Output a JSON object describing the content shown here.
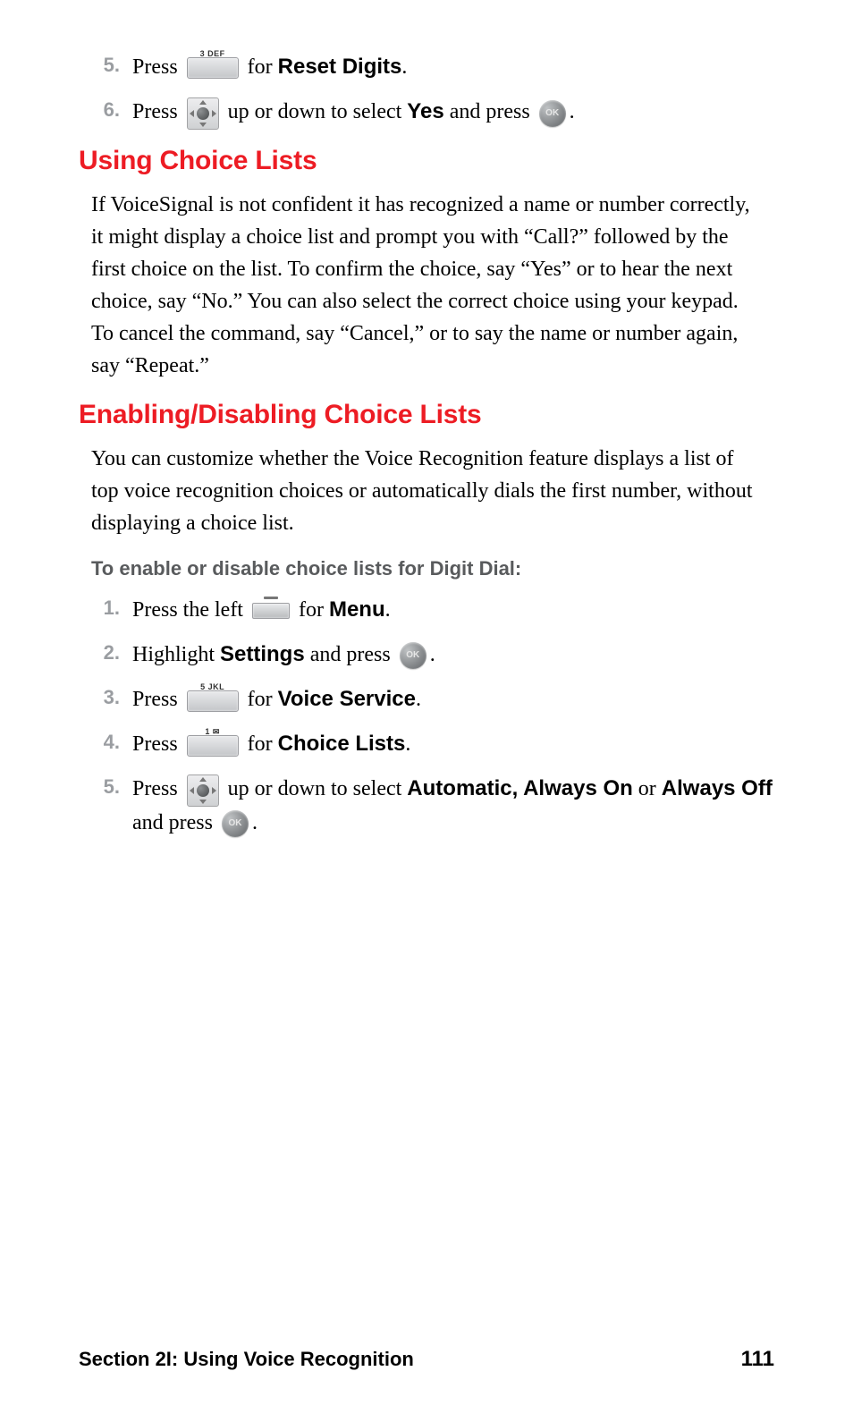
{
  "top_steps": [
    {
      "num": "5.",
      "segments": [
        {
          "t": "Press ",
          "b": false
        },
        {
          "icon": "key3",
          "label": "3 DEF"
        },
        {
          "t": " for ",
          "b": false
        },
        {
          "t": "Reset Digits",
          "b": true
        },
        {
          "t": ".",
          "b": false
        }
      ]
    },
    {
      "num": "6.",
      "segments": [
        {
          "t": "Press ",
          "b": false
        },
        {
          "icon": "nav"
        },
        {
          "t": " up or down to select ",
          "b": false
        },
        {
          "t": "Yes",
          "b": true
        },
        {
          "t": " and press ",
          "b": false
        },
        {
          "icon": "ok"
        },
        {
          "t": ".",
          "b": false
        }
      ]
    }
  ],
  "heading1": "Using Choice Lists",
  "para1": "If VoiceSignal is not confident it has recognized a name or number correctly, it might display a choice list and prompt you with “Call?” followed by the first choice on the list. To confirm the choice, say “Yes” or to hear the next choice, say “No.” You can also select the correct choice using your keypad. To cancel the command, say “Cancel,” or to say the name or number again, say “Repeat.”",
  "heading2": "Enabling/Disabling Choice Lists",
  "para2": "You can customize whether the Voice Recognition feature displays a list of top voice recognition choices or automatically dials the first number, without displaying a choice list.",
  "sub_instr": "To enable or disable choice lists for Digit Dial:",
  "enable_steps": [
    {
      "num": "1.",
      "segments": [
        {
          "t": "Press the left ",
          "b": false
        },
        {
          "icon": "softkey"
        },
        {
          "t": " for ",
          "b": false
        },
        {
          "t": "Menu",
          "b": true
        },
        {
          "t": ".",
          "b": false
        }
      ]
    },
    {
      "num": "2.",
      "segments": [
        {
          "t": "Highlight ",
          "b": false
        },
        {
          "t": "Settings",
          "b": true
        },
        {
          "t": " and press ",
          "b": false
        },
        {
          "icon": "ok"
        },
        {
          "t": ".",
          "b": false
        }
      ]
    },
    {
      "num": "3.",
      "segments": [
        {
          "t": "Press ",
          "b": false
        },
        {
          "icon": "key5",
          "label": "5 JKL"
        },
        {
          "t": " for ",
          "b": false
        },
        {
          "t": "Voice Service",
          "b": true
        },
        {
          "t": ".",
          "b": false
        }
      ]
    },
    {
      "num": "4.",
      "segments": [
        {
          "t": "Press ",
          "b": false
        },
        {
          "icon": "key1",
          "label": "1 ✉"
        },
        {
          "t": " for ",
          "b": false
        },
        {
          "t": "Choice Lists",
          "b": true
        },
        {
          "t": ".",
          "b": false
        }
      ]
    },
    {
      "num": "5.",
      "segments": [
        {
          "t": "Press ",
          "b": false
        },
        {
          "icon": "nav"
        },
        {
          "t": " up or down to select ",
          "b": false
        },
        {
          "t": "Automatic, Always On",
          "b": true
        },
        {
          "t": " or ",
          "b": false
        },
        {
          "t": "Always Off",
          "b": true
        },
        {
          "t": " and press ",
          "b": false
        },
        {
          "icon": "ok"
        },
        {
          "t": ".",
          "b": false
        }
      ]
    }
  ],
  "footer": {
    "section": "Section 2I: Using Voice Recognition",
    "page": "111"
  }
}
